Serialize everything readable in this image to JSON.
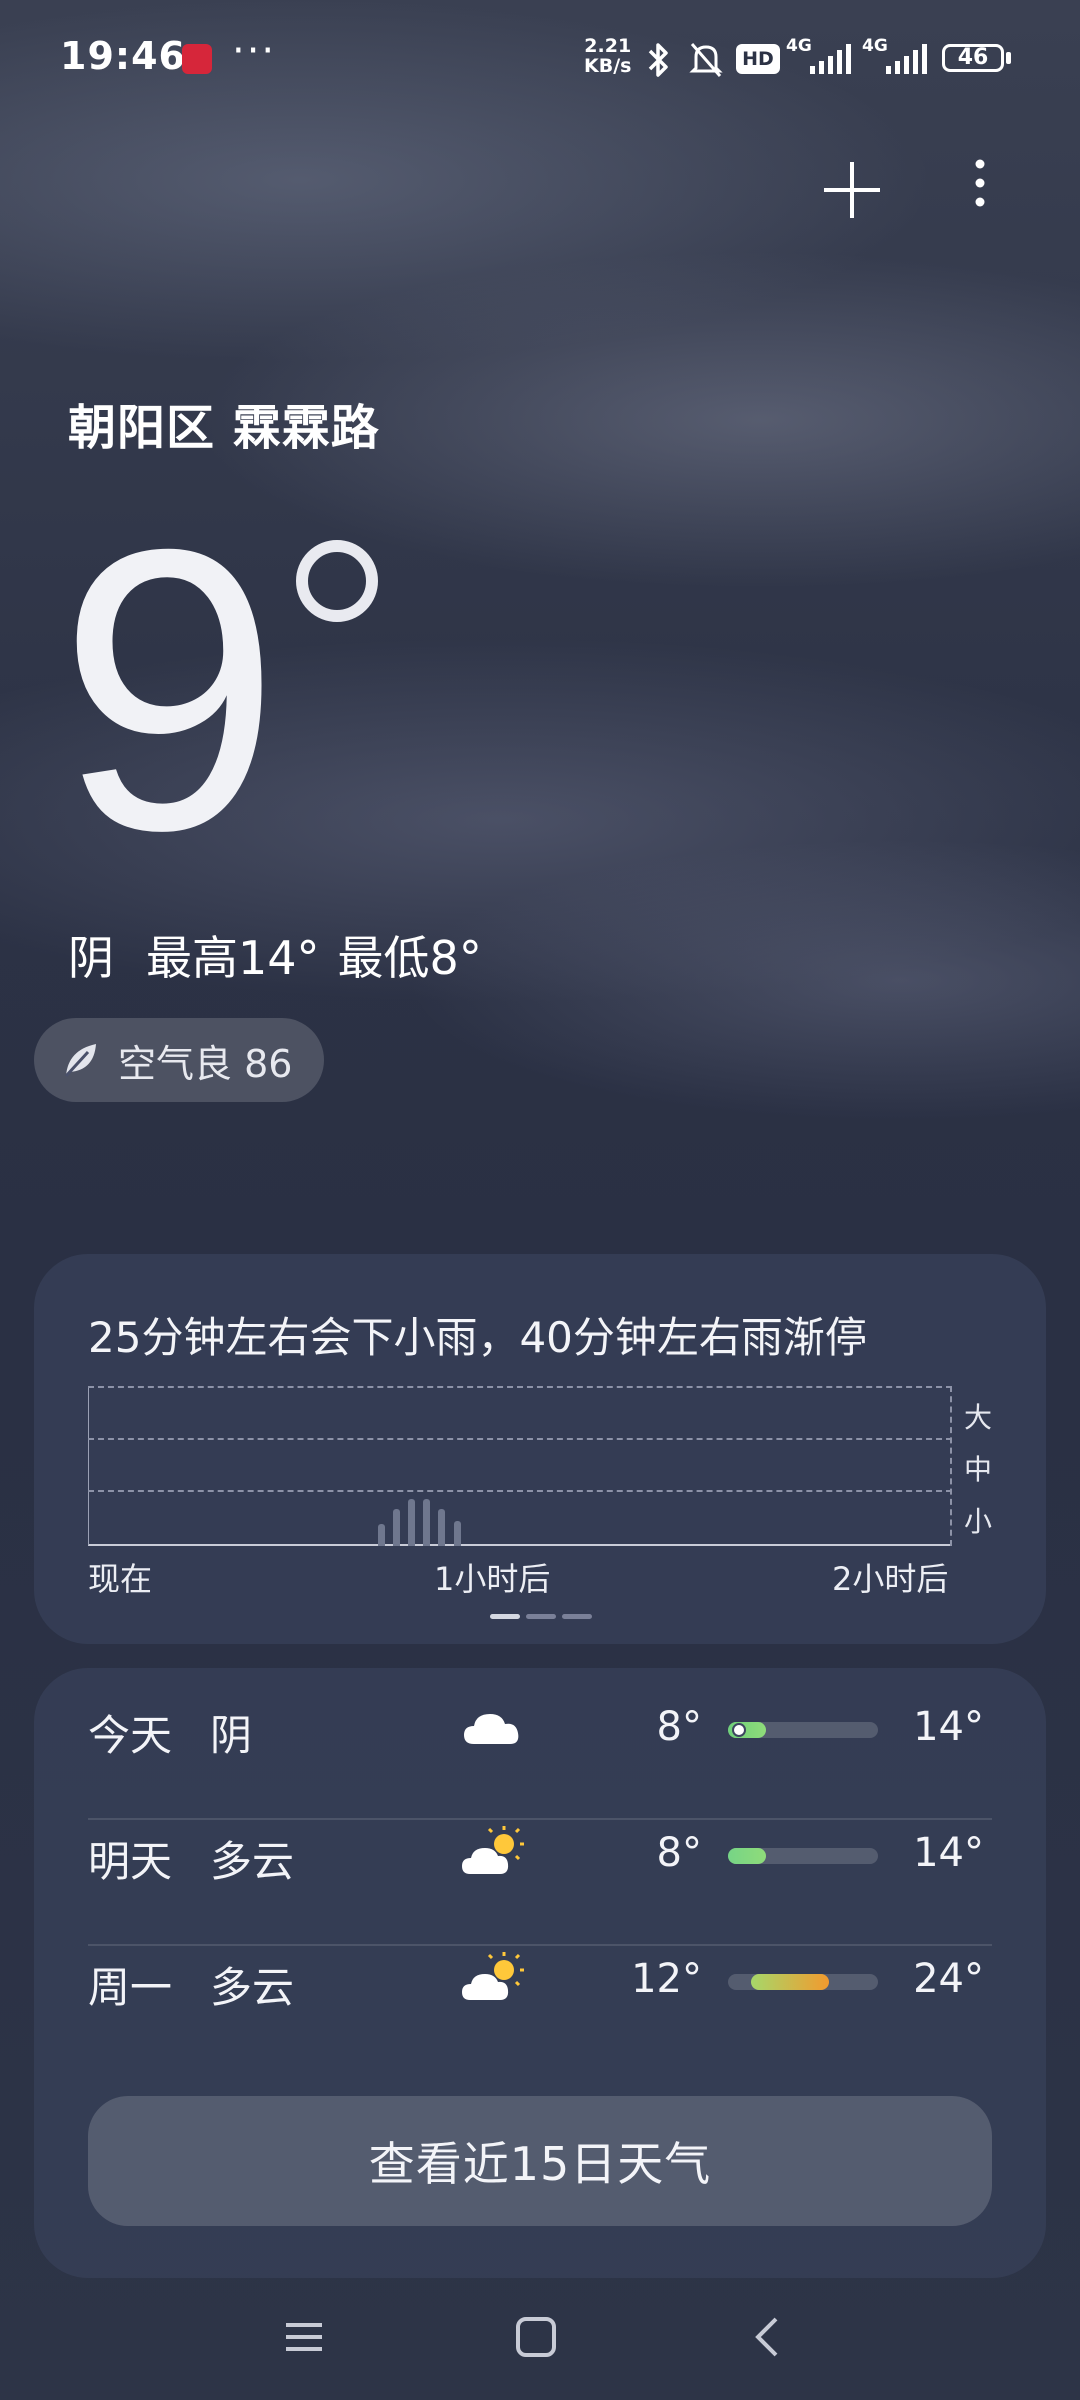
{
  "status_bar": {
    "time": "19:46",
    "speed_value": "2.21",
    "speed_unit": "KB/s",
    "battery": "46",
    "net1": "4G",
    "net2": "4G",
    "hd_badge": "HD"
  },
  "location": "朝阳区 霖霖路",
  "current": {
    "temp": "9",
    "condition": "阴",
    "high": "最高14°",
    "low": "最低8°"
  },
  "air_quality": "空气良 86",
  "precip": {
    "title": "25分钟左右会下小雨，40分钟左右雨渐停",
    "levels": [
      "大",
      "中",
      "小"
    ],
    "x_labels": [
      "现在",
      "1小时后",
      "2小时后"
    ],
    "chart_data": {
      "type": "bar",
      "x_range_minutes": [
        0,
        120
      ],
      "x": [
        25,
        28,
        31,
        34,
        37,
        40
      ],
      "values": [
        0.14,
        0.24,
        0.3,
        0.3,
        0.24,
        0.16
      ],
      "ylim": [
        0,
        1
      ],
      "ylevels": [
        "小",
        "中",
        "大"
      ]
    }
  },
  "forecast": [
    {
      "day": "今天",
      "cond": "阴",
      "icon": "cloud-icon",
      "lo": "8°",
      "hi": "14°",
      "range": [
        0.0,
        0.25
      ],
      "colors": [
        "#6fd07a",
        "#8fdc7a"
      ],
      "current_dot": true
    },
    {
      "day": "明天",
      "cond": "多云",
      "icon": "partly-cloudy-icon",
      "lo": "8°",
      "hi": "14°",
      "range": [
        0.0,
        0.25
      ],
      "colors": [
        "#76d486",
        "#8fdc7a"
      ],
      "current_dot": false
    },
    {
      "day": "周一",
      "cond": "多云",
      "icon": "partly-cloudy-icon",
      "lo": "12°",
      "hi": "24°",
      "range": [
        0.15,
        0.67
      ],
      "colors": [
        "#a6d86a",
        "#f29a2e"
      ],
      "current_dot": false
    }
  ],
  "more_button": "查看近15日天气"
}
